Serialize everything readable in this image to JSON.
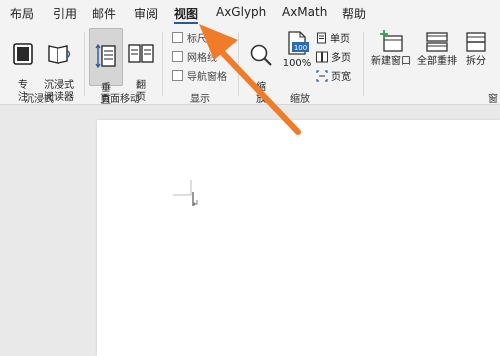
{
  "tabs": [
    {
      "label": "布局",
      "active": false
    },
    {
      "label": "引用",
      "active": false
    },
    {
      "label": "邮件",
      "active": false
    },
    {
      "label": "审阅",
      "active": false
    },
    {
      "label": "视图",
      "active": true
    },
    {
      "label": "AxGlyph",
      "active": false
    },
    {
      "label": "AxMath",
      "active": false
    },
    {
      "label": "帮助",
      "active": false
    }
  ],
  "ribbon": {
    "immersive": {
      "focus_label": "专\n注",
      "reader_label": "沉浸式\n阅读器",
      "group_label": "沉浸式"
    },
    "page_movement": {
      "vertical_label": "垂\n直",
      "flip_label": "翻\n页",
      "group_label": "页面移动"
    },
    "show": {
      "ruler_label": "标尺",
      "gridlines_label": "网格线",
      "nav_pane_label": "导航窗格",
      "group_label": "显示"
    },
    "zoom": {
      "zoom_label": "缩\n放",
      "hundred_label": "100%",
      "hundred_icon_text": "100",
      "one_page_label": "单页",
      "multi_page_label": "多页",
      "page_width_label": "页宽",
      "group_label": "缩放"
    },
    "window": {
      "new_window_label": "新建窗口",
      "arrange_all_label": "全部重排",
      "split_label": "拆分",
      "group_label_partial": "窗"
    }
  },
  "annotation": {
    "arrow_color": "#f07c2a"
  },
  "colors": {
    "accent": "#2b579a",
    "page": "#ffffff",
    "ribbon_bg": "#f3f3f3",
    "doc_bg": "#e9e9e9"
  }
}
